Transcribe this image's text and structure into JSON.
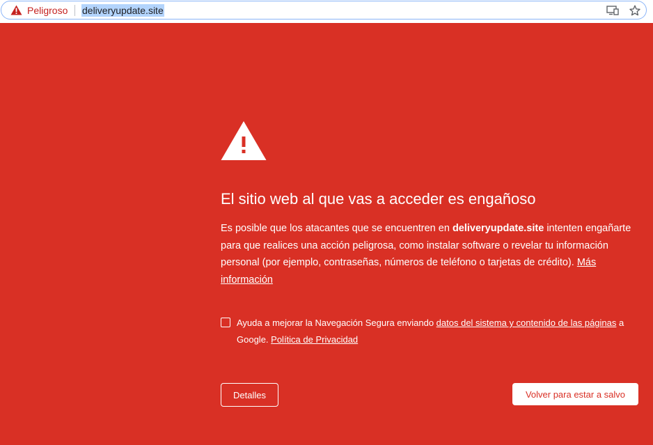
{
  "omnibox": {
    "status_icon": "warning-triangle-icon",
    "status_label": "Peligroso",
    "url": "deliveryupdate.site",
    "cast_icon": "cast-icon",
    "bookmark_icon": "star-icon",
    "status_color": "#c5221f"
  },
  "interstitial": {
    "background_color": "#d93025",
    "icon": "warning-triangle-icon",
    "heading": "El sitio web al que vas a acceder es engañoso",
    "explanation": {
      "before": "Es posible que los atacantes que se encuentren en ",
      "domain": "deliveryupdate.site",
      "after": " intenten engañarte para que realices una acción peligrosa, como instalar software o revelar tu información personal (por ejemplo, contraseñas, números de teléfono o tarjetas de crédito). ",
      "learn_more": "Más información"
    },
    "optin": {
      "checked": false,
      "before": "Ayuda a mejorar la Navegación Segura enviando ",
      "link": "datos del sistema y contenido de las páginas",
      "middle": " a Google. ",
      "privacy_link": "Política de Privacidad"
    },
    "details_button": "Detalles",
    "back_button": "Volver para estar a salvo"
  }
}
